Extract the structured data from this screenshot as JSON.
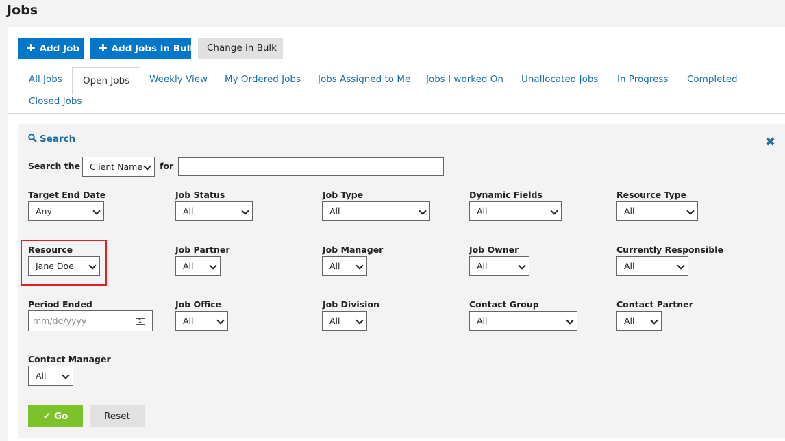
{
  "page": {
    "title": "Jobs"
  },
  "toolbar": {
    "add_job": "Add Job",
    "add_jobs_bulk": "Add Jobs in Bulk",
    "change_bulk": "Change in Bulk",
    "plus_symbol": "✚"
  },
  "tabs": [
    "All Jobs",
    "Open Jobs",
    "Weekly View",
    "My Ordered Jobs",
    "Jobs Assigned to Me",
    "Jobs I worked On",
    "Unallocated Jobs",
    "In Progress",
    "Completed",
    "Closed Jobs"
  ],
  "search": {
    "title": "Search",
    "search_the_label": "Search the",
    "search_field_value": "Client Name",
    "for_label": "for",
    "for_value": "",
    "close_symbol": "✖",
    "search_symbol": "🔍"
  },
  "filters": {
    "target_end_date": {
      "label": "Target End Date",
      "value": "Any"
    },
    "job_status": {
      "label": "Job Status",
      "value": "All"
    },
    "job_type": {
      "label": "Job Type",
      "value": "All"
    },
    "dynamic_fields": {
      "label": "Dynamic Fields",
      "value": "All"
    },
    "resource_type": {
      "label": "Resource Type",
      "value": "All"
    },
    "resource": {
      "label": "Resource",
      "value": "Jane Doe"
    },
    "job_partner": {
      "label": "Job Partner",
      "value": "All"
    },
    "job_manager": {
      "label": "Job Manager",
      "value": "All"
    },
    "job_owner": {
      "label": "Job Owner",
      "value": "All"
    },
    "currently_responsible": {
      "label": "Currently Responsible",
      "value": "All"
    },
    "period_ended": {
      "label": "Period Ended",
      "placeholder": "mm/dd/yyyy",
      "calendar_day": "1"
    },
    "job_office": {
      "label": "Job Office",
      "value": "All"
    },
    "job_division": {
      "label": "Job Division",
      "value": "All"
    },
    "contact_group": {
      "label": "Contact Group",
      "value": "All"
    },
    "contact_partner": {
      "label": "Contact Partner",
      "value": "All"
    },
    "contact_manager": {
      "label": "Contact Manager",
      "value": "All"
    }
  },
  "actions": {
    "go": "Go",
    "go_check": "✔",
    "reset": "Reset"
  },
  "colors": {
    "primary": "#0077c8",
    "link": "#1c6ea4",
    "go": "#7dc12b",
    "highlight": "#e02020"
  }
}
